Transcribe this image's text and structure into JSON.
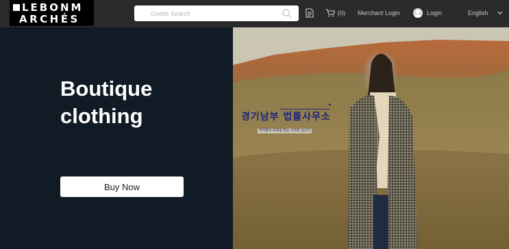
{
  "brand": {
    "line1": "LEBONM",
    "line2": "ARCHÉS"
  },
  "search": {
    "placeholder": "Godds Search"
  },
  "header": {
    "cart_count": "(0)",
    "merchant_login": "Merchant Login",
    "login": "Login",
    "language": "English"
  },
  "hero": {
    "title": "Boutique clothing",
    "button_label": "Buy Now",
    "overlay_name": "경기남부 법률사무소",
    "overlay_subtitle": "여러분의 보호를 받는 사회와 됩니다"
  },
  "colors": {
    "topbar": "#2a2a2a",
    "hero_bg": "#111b26",
    "overlay_text": "#1c2580"
  },
  "icons": [
    "logo-square",
    "search-icon",
    "document-icon",
    "cart-icon",
    "user-avatar-icon",
    "chevron-down-icon"
  ]
}
